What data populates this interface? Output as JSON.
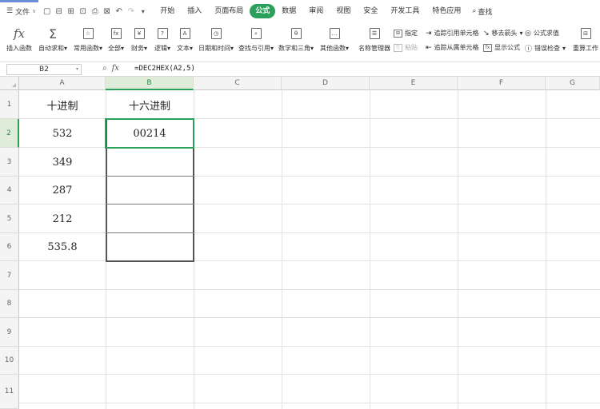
{
  "menubar": {
    "menu_label": "文件",
    "tabs": [
      "开始",
      "插入",
      "页面布局",
      "公式",
      "数据",
      "审阅",
      "视图",
      "安全",
      "开发工具",
      "特色应用"
    ],
    "active_tab": "公式",
    "search_label": "查找"
  },
  "ribbon": {
    "insert_function": "插入函数",
    "autosum": "自动求和",
    "common": "常用函数",
    "all": "全部",
    "finance": "财务",
    "logic": "逻辑",
    "text": "文本",
    "datetime": "日期和时间",
    "lookup": "查找与引用",
    "math": "数学和三角",
    "other": "其他函数",
    "name_manager": "名称管理器",
    "specify": "指定",
    "paste": "粘贴",
    "trace_precedents": "追踪引用单元格",
    "trace_dependents": "追踪从属单元格",
    "remove_arrows": "移去箭头",
    "show_formulas": "显示公式",
    "evaluate": "公式求值",
    "error_check": "错误检查",
    "recalc": "重算工作"
  },
  "formula_bar": {
    "cell_ref": "B2",
    "formula": "=DEC2HEX(A2,5)"
  },
  "sheet": {
    "columns": [
      "A",
      "B",
      "C",
      "D",
      "E",
      "F",
      "G"
    ],
    "rows": [
      "1",
      "2",
      "3",
      "4",
      "5",
      "6",
      "7",
      "8",
      "9",
      "10",
      "11"
    ],
    "header_a": "十进制",
    "header_b": "十六进制",
    "a_values": [
      "532",
      "349",
      "287",
      "212",
      "535.8"
    ],
    "b_values": [
      "00214"
    ]
  },
  "colors": {
    "accent": "#2aa05a",
    "selection_header": "#e0ecda"
  }
}
